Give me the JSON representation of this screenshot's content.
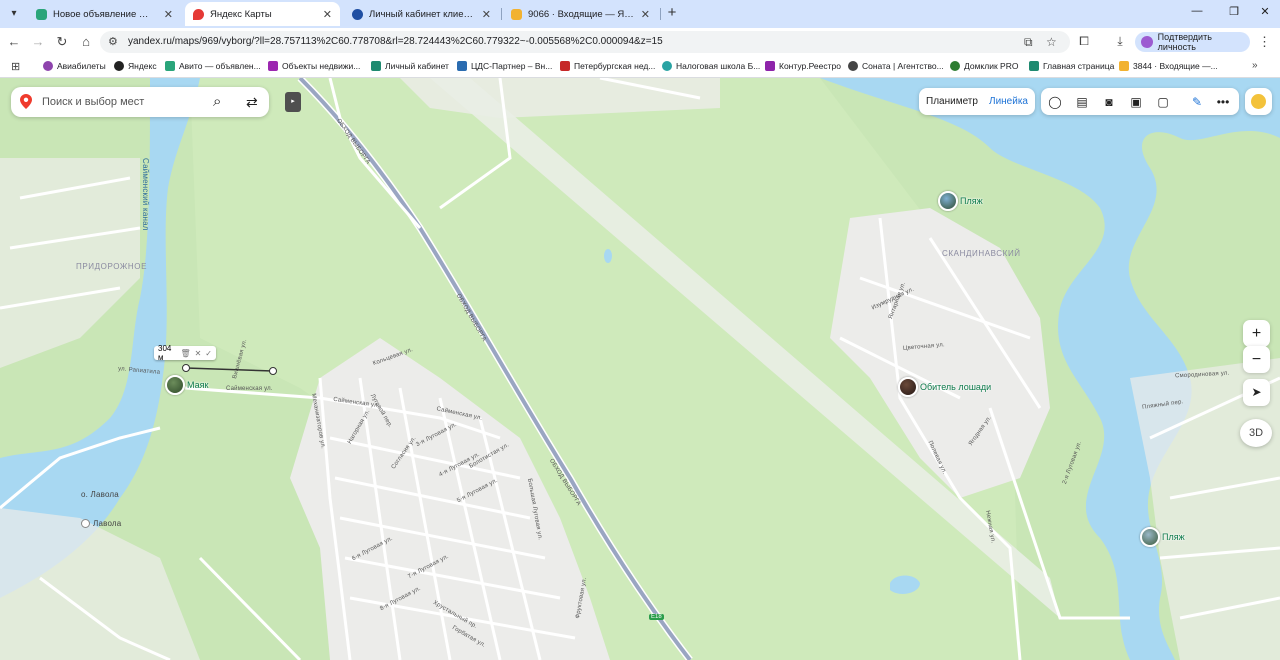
{
  "browser": {
    "tabs": [
      {
        "title": "Новое объявление — Объяв",
        "favicon_color": "#2aa57a"
      },
      {
        "title": "Яндекс Карты",
        "favicon_color": "#e53935",
        "active": true
      },
      {
        "title": "Личный кабинет клиента",
        "favicon_color": "#1f4fa3"
      },
      {
        "title": "9066 · Входящие — Яндекс По",
        "favicon_color": "#f2b230"
      }
    ],
    "url": "yandex.ru/maps/969/vyborg/?ll=28.757113%2C60.778708&rl=28.724443%2C60.779322~-0.005568%2C0.000094&z=15",
    "verify_label": "Подтвердить личность",
    "bookmarks": [
      {
        "label": "Авиабилеты",
        "color": "#8e44ad"
      },
      {
        "label": "Яндекс",
        "color": "#222222"
      },
      {
        "label": "Авито — объявлен...",
        "color": "#2aa57a"
      },
      {
        "label": "Объекты недвижи...",
        "color": "#9c27b0"
      },
      {
        "label": "Личный кабинет",
        "color": "#1f8a70"
      },
      {
        "label": "ЦДС-Партнер – Вн...",
        "color": "#2b6cb0"
      },
      {
        "label": "Петербургская нед...",
        "color": "#c62828"
      },
      {
        "label": "Налоговая школа Б...",
        "color": "#29a3a3"
      },
      {
        "label": "Контур.Реестро",
        "color": "#8e24aa"
      },
      {
        "label": "Соната | Агентство...",
        "color": "#444444"
      },
      {
        "label": "Домклик PRO",
        "color": "#2e7d32"
      },
      {
        "label": "Главная страница",
        "color": "#1f8a70"
      },
      {
        "label": "3844 · Входящие —...",
        "color": "#f2b230"
      }
    ]
  },
  "map": {
    "search": {
      "placeholder": "Поиск и выбор мест"
    },
    "ruler_modes": {
      "planimeter": "Планиметр",
      "ruler": "Линейка"
    },
    "controls": {
      "zoom_in": "+",
      "zoom_out": "−",
      "three_d": "3D"
    },
    "ruler_distance": "304 м",
    "pois": [
      {
        "name": "Маяк"
      },
      {
        "name": "Пляж"
      },
      {
        "name": "Обитель лошади"
      },
      {
        "name": "Пляж"
      }
    ],
    "labels": {
      "area_pridorozhnoe": "ПРИДОРОЖНОЕ",
      "area_skandinavsky": "СКАНДИНАВСКИЙ",
      "island": "о. Лавола",
      "lavola": "Лавола",
      "canal": "Сайменский канал",
      "highway_1": "ОБХОД ВЫБОРГА",
      "highway_2": "ОБХОД ВЫБОРГА",
      "highway_3": "ОБХОД ВЫБОРГА",
      "highway_code": "E18",
      "streets": [
        "Сайменская ул.",
        "Сайменская ул.",
        "Сайменская ул.",
        "Кольцевая ул.",
        "Луговой пер.",
        "Нагорная ул.",
        "Согласия ул.",
        "Болотистая ул.",
        "Большая Луговая ул.",
        "3-я Луговая ул.",
        "4-я Луговая ул.",
        "5-я Луговая ул.",
        "6-я Луговая ул.",
        "7-я Луговая ул.",
        "8-я Луговая ул.",
        "Хрустальный пр.",
        "Горбатая ул.",
        "Фруктовая ул.",
        "Механизаторов ул.",
        "ул. Рапиатила",
        "Изумрудная ул.",
        "Янтарная ул.",
        "Цветочная ул.",
        "Нежная ул.",
        "Смородиновая ул.",
        "Пляжный пер.",
        "2-я Луговая ул.",
        "Полевая ул.",
        "Ягодная ул.",
        "Вишнёвая ул."
      ]
    }
  }
}
